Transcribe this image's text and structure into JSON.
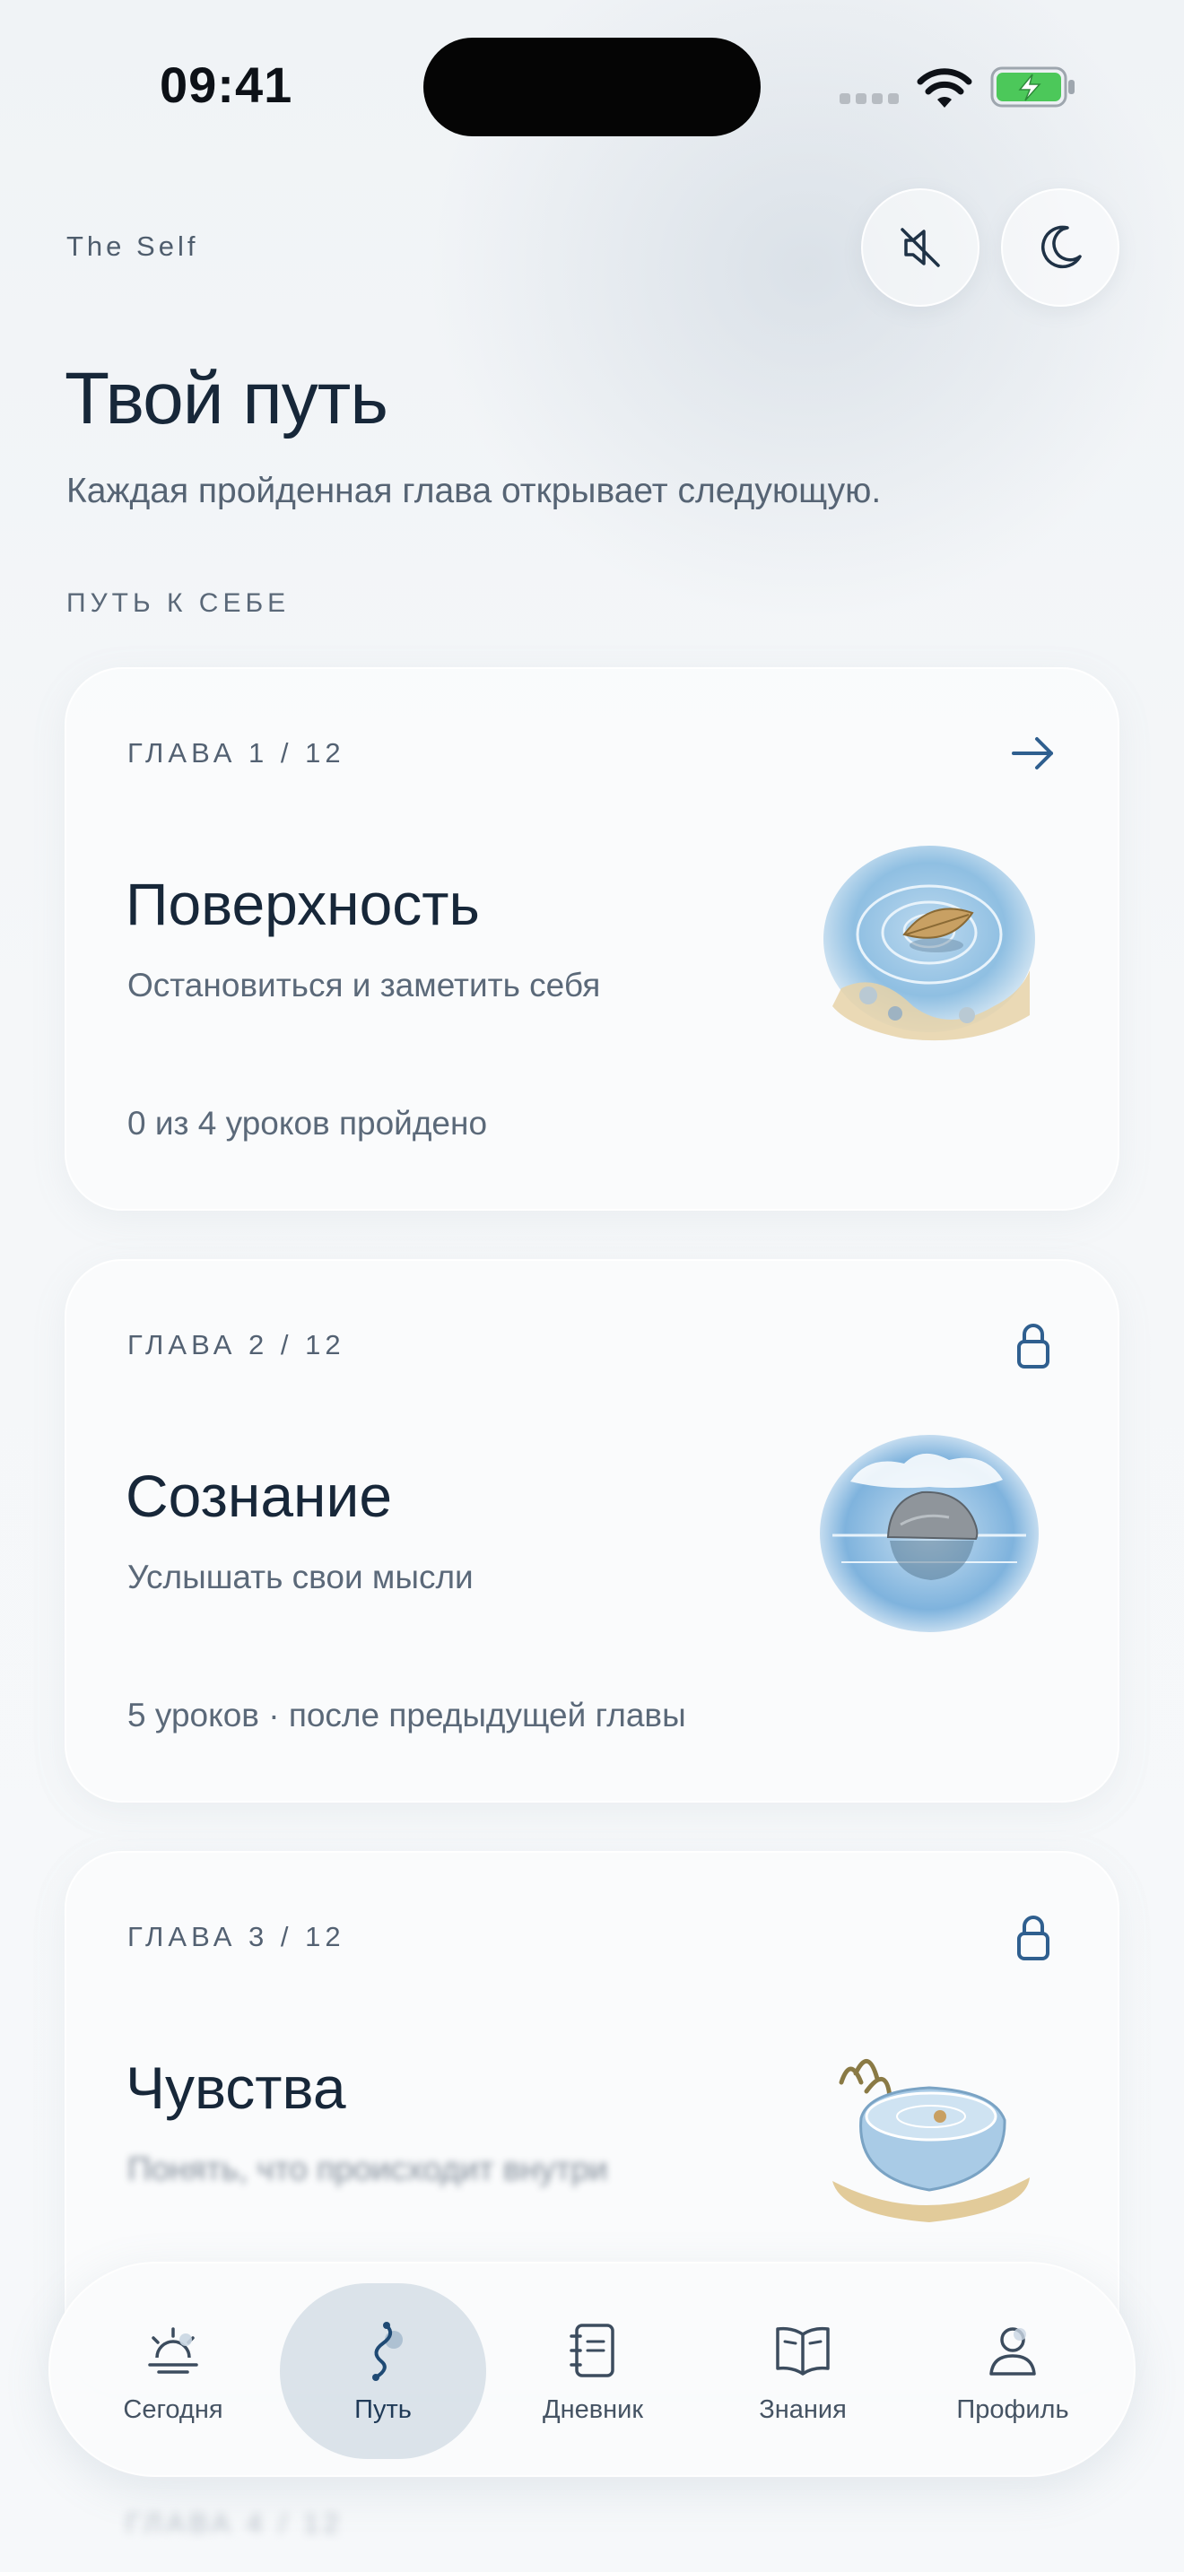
{
  "status_bar": {
    "time": "09:41"
  },
  "header": {
    "brand": "The Self",
    "mute_icon": "speaker-mute-icon",
    "theme_icon": "moon-icon"
  },
  "page": {
    "title": "Твой путь",
    "subtitle": "Каждая пройденная глава открывает следующую.",
    "section_label": "ПУТЬ К СЕБЕ"
  },
  "chapters": [
    {
      "chapter": "ГЛАВА 1 / 12",
      "title": "Поверхность",
      "description": "Остановиться и заметить себя",
      "progress": "0 из 4 уроков пройдено",
      "state": "open",
      "action_icon": "arrow-right-icon",
      "art": "leaf-on-water"
    },
    {
      "chapter": "ГЛАВА 2 / 12",
      "title": "Сознание",
      "description": "Услышать свои мысли",
      "progress": "5 уроков · после предыдущей главы",
      "state": "locked",
      "action_icon": "lock-icon",
      "art": "stone-in-lake"
    },
    {
      "chapter": "ГЛАВА 3 / 12",
      "title": "Чувства",
      "description": "Понять, что происходит внутри",
      "progress": "",
      "state": "locked",
      "action_icon": "lock-icon",
      "art": "water-bowl"
    }
  ],
  "next_chapter_partial": "ГЛАВА 4 / 12",
  "tabbar": {
    "active": "Путь",
    "items": [
      {
        "label": "Сегодня",
        "icon": "sunrise-icon"
      },
      {
        "label": "Путь",
        "icon": "path-icon"
      },
      {
        "label": "Дневник",
        "icon": "journal-icon"
      },
      {
        "label": "Знания",
        "icon": "book-icon"
      },
      {
        "label": "Профиль",
        "icon": "profile-icon"
      }
    ]
  },
  "colors": {
    "accent": "#2f5f8f",
    "text_primary": "#172739",
    "text_secondary": "#5b6979",
    "background": "#f3f6f9",
    "battery_green": "#4cc85a"
  }
}
